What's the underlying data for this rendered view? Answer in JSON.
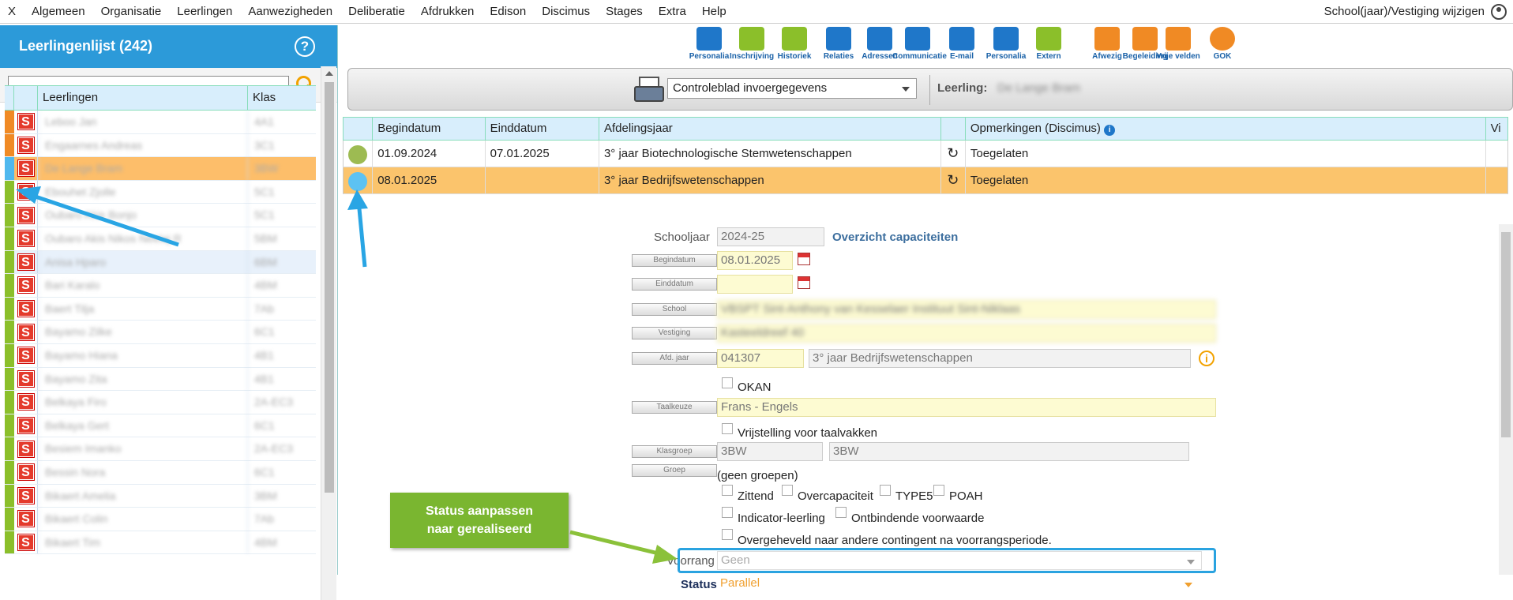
{
  "menubar": {
    "items": [
      "X",
      "Algemeen",
      "Organisatie",
      "Leerlingen",
      "Aanwezigheden",
      "Deliberatie",
      "Afdrukken",
      "Edison",
      "Discimus",
      "Stages",
      "Extra",
      "Help"
    ],
    "right_label": "School(jaar)/Vestiging wijzigen"
  },
  "left": {
    "title": "Leerlingenlijst (242)",
    "help": "?",
    "search": {
      "value": "",
      "placeholder": ""
    },
    "columns": {
      "leerlingen": "Leerlingen",
      "klas": "Klas"
    },
    "rows": [
      {
        "color": "#f08a24",
        "name": "Leboo Jan",
        "klas": "4A1",
        "state": ""
      },
      {
        "color": "#f08a24",
        "name": "Engaarnes Andreas",
        "klas": "3C1",
        "state": ""
      },
      {
        "color": "#4fb8ee",
        "name": "De Lange Bram",
        "klas": "3BW",
        "state": "selected"
      },
      {
        "color": "#8bbf2a",
        "name": "Ebouhet Zjolle",
        "klas": "5C1",
        "state": ""
      },
      {
        "color": "#8bbf2a",
        "name": "Oubaro Akis Bonjo",
        "klas": "5C1",
        "state": ""
      },
      {
        "color": "#8bbf2a",
        "name": "Oubaro Akis Nikos Neelaj R",
        "klas": "5BM",
        "state": ""
      },
      {
        "color": "#8bbf2a",
        "name": "Anisa Hparo",
        "klas": "6BM",
        "state": "hover"
      },
      {
        "color": "#8bbf2a",
        "name": "Bari Karalo",
        "klas": "4BM",
        "state": ""
      },
      {
        "color": "#8bbf2a",
        "name": "Baert Tilja",
        "klas": "7Ab",
        "state": ""
      },
      {
        "color": "#8bbf2a",
        "name": "Bayamo Zilke",
        "klas": "6C1",
        "state": ""
      },
      {
        "color": "#8bbf2a",
        "name": "Bayamo Hiana",
        "klas": "4B1",
        "state": ""
      },
      {
        "color": "#8bbf2a",
        "name": "Bayamo Zita",
        "klas": "4B1",
        "state": ""
      },
      {
        "color": "#8bbf2a",
        "name": "Belkaya Firo",
        "klas": "2A-EC3",
        "state": ""
      },
      {
        "color": "#8bbf2a",
        "name": "Belkaya Gert",
        "klas": "6C1",
        "state": ""
      },
      {
        "color": "#8bbf2a",
        "name": "Besiem Imanko",
        "klas": "2A-EC3",
        "state": ""
      },
      {
        "color": "#8bbf2a",
        "name": "Bessin Nora",
        "klas": "6C1",
        "state": ""
      },
      {
        "color": "#8bbf2a",
        "name": "Bikaert Amelia",
        "klas": "3BM",
        "state": ""
      },
      {
        "color": "#8bbf2a",
        "name": "Bikaert Colin",
        "klas": "7Ab",
        "state": ""
      },
      {
        "color": "#8bbf2a",
        "name": "Bikaert Tim",
        "klas": "4BM",
        "state": ""
      }
    ]
  },
  "toolbar": [
    {
      "label": "Personalia",
      "icon": "id-card-icon"
    },
    {
      "label": "Inschrijving",
      "icon": "clipboard-icon"
    },
    {
      "label": "Historiek",
      "icon": "list-icon"
    },
    {
      "label": "Relaties",
      "icon": "people-icon"
    },
    {
      "label": "Adressen",
      "icon": "house-icon"
    },
    {
      "label": "Communicatie",
      "icon": "phone-icon"
    },
    {
      "label": "E-mail",
      "icon": "envelope-icon"
    },
    {
      "label": "Personalia",
      "icon": "id-card-plus-icon"
    },
    {
      "label": "Extern",
      "icon": "school-icon"
    },
    {
      "label": "Afwezig",
      "icon": "calendar-person-icon"
    },
    {
      "label": "Begeleiding",
      "icon": "folder-person-icon"
    },
    {
      "label": "Vrije velden",
      "icon": "pencil-icon"
    },
    {
      "label": "GOK",
      "icon": "globe-icon"
    }
  ],
  "bar2": {
    "report_select": "Controleblad invoergegevens",
    "leerling_label": "Leerling:",
    "leerling_value": "De Lange Bram"
  },
  "grid": {
    "columns": {
      "begin": "Begindatum",
      "eind": "Einddatum",
      "afdeling": "Afdelingsjaar",
      "opm": "Opmerkingen (Discimus)",
      "vi": "Vi"
    },
    "rows": [
      {
        "dot": "#9dbb52",
        "begin": "01.09.2024",
        "eind": "07.01.2025",
        "afdeling": "3° jaar Biotechnologische Stemwetenschappen",
        "opm": "Toegelaten"
      },
      {
        "dot": "#5cc2f2",
        "begin": "08.01.2025",
        "eind": "",
        "afdeling": "3° jaar Bedrijfswetenschappen",
        "opm": "Toegelaten"
      }
    ]
  },
  "form": {
    "schooljaar_label": "Schooljaar",
    "schooljaar": "2024-25",
    "overzicht": "Overzicht capaciteiten",
    "begindatum_label": "Begindatum",
    "begindatum": "08.01.2025",
    "einddatum_label": "Einddatum",
    "einddatum": "",
    "school_label": "School",
    "school": "VBSPT Sint-Anthony van Kesselaer Instituut Sint-Niklaas",
    "vestiging_label": "Vestiging",
    "vestiging": "Kasteeldreef 40",
    "afd_label": "Afd. jaar",
    "afd_code": "041307",
    "afd_name": "3° jaar Bedrijfswetenschappen",
    "okan": "OKAN",
    "taalkeuze_label": "Taalkeuze",
    "taalkeuze": "Frans - Engels",
    "vrijstelling": "Vrijstelling voor taalvakken",
    "klasgroep_label": "Klasgroep",
    "klasgroep1": "3BW",
    "klasgroep2": "3BW",
    "groep_label": "Groep",
    "groep": "(geen groepen)",
    "zittend": "Zittend",
    "overcap": "Overcapaciteit",
    "type5": "TYPE5",
    "poah": "POAH",
    "indicator": "Indicator-leerling",
    "ontbindende": "Ontbindende voorwaarde",
    "overgeheveld": "Overgeheveld naar andere contingent na voorrangsperiode.",
    "voorrang_label": "Voorrang",
    "voorrang": "Geen",
    "status_label": "Status",
    "status": "Parallel"
  },
  "callout": {
    "line1": "Status aanpassen",
    "line2": "naar gerealiseerd"
  },
  "colors": {
    "accent": "#2c9ad9",
    "selected_row": "#fbc46c",
    "callout": "#7ab630",
    "arrow_blue": "#29a5e4"
  }
}
